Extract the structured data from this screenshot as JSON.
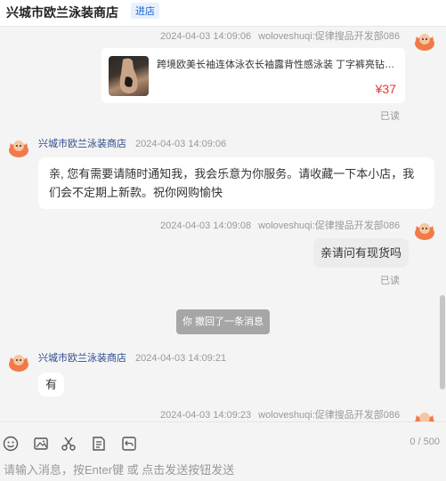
{
  "header": {
    "shop_name": "兴城市欧兰泳装商店",
    "enter_label": "进店"
  },
  "messages": {
    "m1_meta": {
      "time": "2024-04-03 14:09:06",
      "agent": "woloveshuqi:促律搜品开发部086"
    },
    "product": {
      "title": "跨境欧美长袖连体泳衣长袖露背性感泳装 丁字裤亮钻比基尼泳衣",
      "price": "¥37"
    },
    "m1_read": "已读",
    "m2_meta": {
      "shop": "兴城市欧兰泳装商店",
      "time": "2024-04-03 14:09:06"
    },
    "m2_text": "亲, 您有需要请随时通知我，我会乐意为你服务。请收藏一下本小店，我们会不定期上新款。祝你网购愉快",
    "m3_meta": {
      "time": "2024-04-03 14:09:08",
      "agent": "woloveshuqi:促律搜品开发部086"
    },
    "m3_text": "亲请问有现货吗",
    "m3_read": "已读",
    "recall_notice": "你 撤回了一条消息",
    "m4_meta": {
      "shop": "兴城市欧兰泳装商店",
      "time": "2024-04-03 14:09:21"
    },
    "m4_text": "有",
    "m5_meta": {
      "time": "2024-04-03 14:09:23",
      "agent": "woloveshuqi:促律搜品开发部086"
    }
  },
  "toolbar": {
    "icons": [
      "emoji-icon",
      "image-icon",
      "scissors-icon",
      "quick-reply-icon",
      "history-icon"
    ],
    "counter": "0 / 500",
    "input_placeholder": "请输入消息，按Enter键 或 点击发送按钮发送"
  },
  "colors": {
    "price": "#e4393c",
    "shop_link": "#2b4a8b",
    "enter_btn": "#1b64c8",
    "avatar_orange": "#f07a4a"
  }
}
